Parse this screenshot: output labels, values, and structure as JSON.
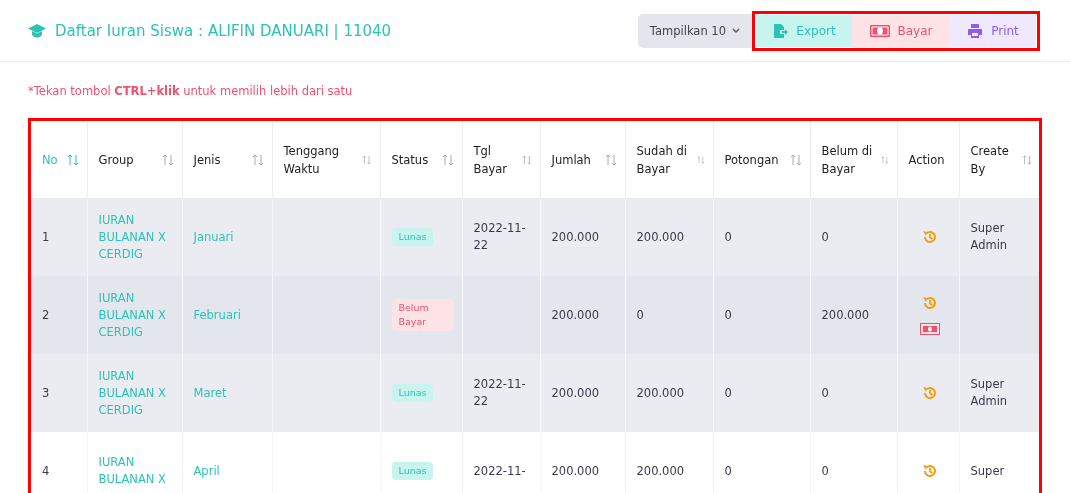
{
  "header": {
    "title": "Daftar Iuran Siswa : ALIFIN DANUARI | 11040",
    "page_size": "Tampilkan 10",
    "buttons": [
      {
        "kind": "export",
        "label": "Export"
      },
      {
        "kind": "pay",
        "label": "Bayar"
      },
      {
        "kind": "print",
        "label": "Print"
      }
    ]
  },
  "note": "*Tekan tombol **CTRL+klik** untuk memilih lebih dari satu",
  "table": {
    "columns": [
      {
        "label": "No",
        "sortable": true,
        "sort_active": true
      },
      {
        "label": "Group",
        "sortable": true,
        "sort_active": false
      },
      {
        "label": "Jenis",
        "sortable": true,
        "sort_active": false
      },
      {
        "label": "Tenggang Waktu",
        "sortable": true,
        "sort_active": false
      },
      {
        "label": "Status",
        "sortable": true,
        "sort_active": false
      },
      {
        "label": "Tgl Bayar",
        "sortable": true,
        "sort_active": false
      },
      {
        "label": "Jumlah",
        "sortable": true,
        "sort_active": false
      },
      {
        "label": "Sudah di Bayar",
        "sortable": true,
        "sort_active": false
      },
      {
        "label": "Potongan",
        "sortable": true,
        "sort_active": false
      },
      {
        "label": "Belum di Bayar",
        "sortable": true,
        "sort_active": false
      },
      {
        "label": "Action",
        "sortable": false,
        "sort_active": false
      },
      {
        "label": "Create By",
        "sortable": true,
        "sort_active": false
      }
    ],
    "rows": [
      {
        "selected": true,
        "no": "1",
        "group": "IURAN BULANAN X CERDIG",
        "jenis": "Januari",
        "status": {
          "kind": "paid",
          "label": "Lunas"
        },
        "tgl": "2022-11-22",
        "jumlah": "200.000",
        "sudah": "200.000",
        "potongan": "0",
        "belum": "0",
        "pay_action": false,
        "create_by": "Super Admin"
      },
      {
        "selected": true,
        "no": "2",
        "group": "IURAN BULANAN X CERDIG",
        "jenis": "Februari",
        "status": {
          "kind": "unpaid",
          "label": "Belum Bayar"
        },
        "jumlah": "200.000",
        "sudah": "0",
        "potongan": "0",
        "belum": "200.000",
        "pay_action": true
      },
      {
        "selected": true,
        "no": "3",
        "group": "IURAN BULANAN X CERDIG",
        "jenis": "Maret",
        "status": {
          "kind": "paid",
          "label": "Lunas"
        },
        "tgl": "2022-11-22",
        "jumlah": "200.000",
        "sudah": "200.000",
        "potongan": "0",
        "belum": "0",
        "pay_action": false,
        "create_by": "Super Admin"
      },
      {
        "selected": false,
        "no": "4",
        "group": "IURAN BULANAN X",
        "jenis": "April",
        "status": {
          "kind": "paid",
          "label": "Lunas"
        },
        "tgl": "2022-11-",
        "jumlah": "200.000",
        "sudah": "200.000",
        "potongan": "0",
        "belum": "0",
        "pay_action": false,
        "create_by": "Super"
      }
    ]
  }
}
